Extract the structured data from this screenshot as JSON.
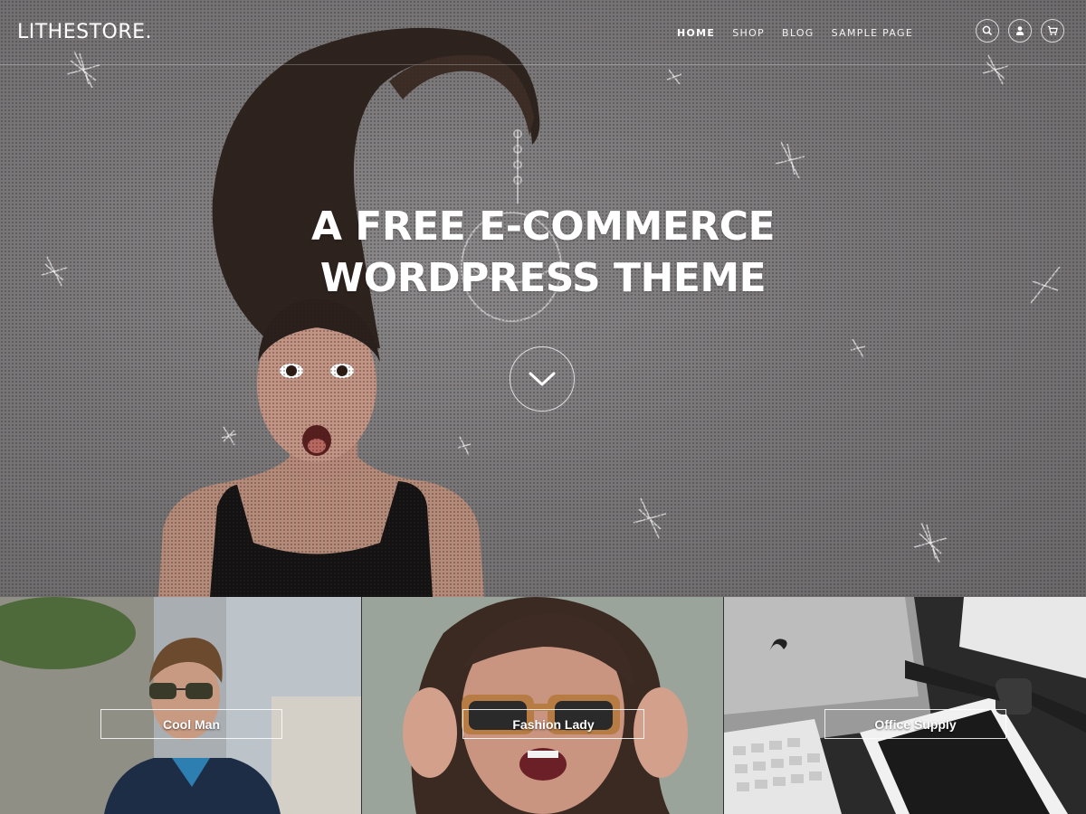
{
  "site": {
    "logo": "LITHESTORE."
  },
  "nav": {
    "items": [
      {
        "label": "HOME",
        "active": true
      },
      {
        "label": "SHOP",
        "active": false
      },
      {
        "label": "BLOG",
        "active": false
      },
      {
        "label": "SAMPLE PAGE",
        "active": false
      }
    ]
  },
  "header_icons": [
    "search-icon",
    "user-icon",
    "cart-icon"
  ],
  "hero": {
    "title_line1": "A FREE E-COMMERCE",
    "title_line2": "WORDPRESS THEME",
    "scroll_icon": "chevron-down-icon"
  },
  "categories": [
    {
      "label": "Cool Man"
    },
    {
      "label": "Fashion Lady"
    },
    {
      "label": "Office Supply"
    }
  ],
  "colors": {
    "hero_bg": "#7a7779",
    "text": "#ffffff",
    "hair": "#2e221d"
  }
}
